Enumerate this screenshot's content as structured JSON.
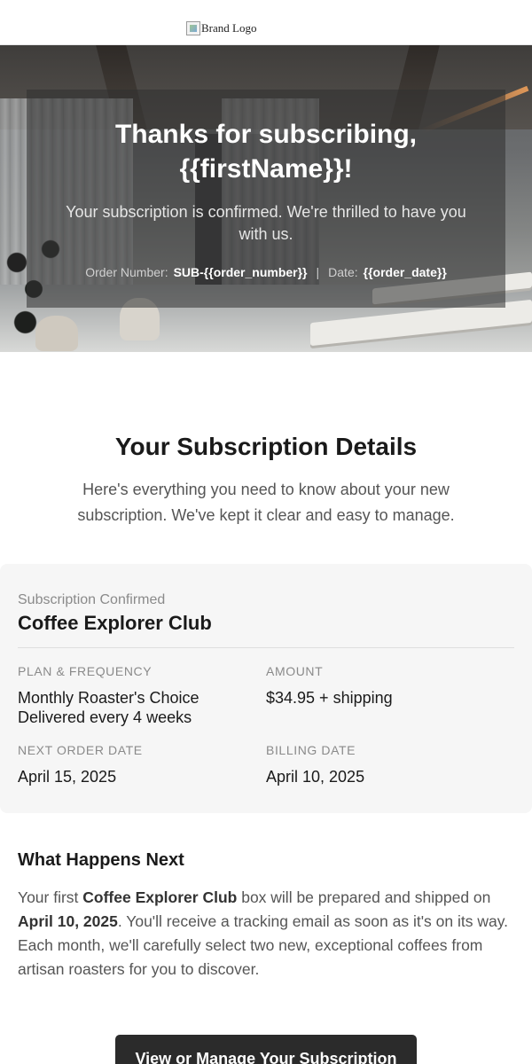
{
  "header": {
    "logo_alt": "Brand Logo",
    "logo_icon": "broken-image-icon"
  },
  "hero": {
    "title_line1": "Thanks for subscribing,",
    "title_line2": "{{firstName}}!",
    "subtitle": "Your subscription is confirmed. We're thrilled to have you with us.",
    "order_number_label": "Order Number:",
    "order_number_value": "SUB-{{order_number}}",
    "separator": "|",
    "date_label": "Date:",
    "date_value": "{{order_date}}"
  },
  "details": {
    "title": "Your Subscription Details",
    "description": "Here's everything you need to know about your new subscription. We've kept it clear and easy to manage."
  },
  "card": {
    "eyebrow": "Subscription Confirmed",
    "title": "Coffee Explorer Club",
    "fields": [
      {
        "label": "Plan & Frequency",
        "value_line1": "Monthly Roaster's Choice",
        "value_line2": "Delivered every 4 weeks"
      },
      {
        "label": "Amount",
        "value_line1": "$34.95 + shipping"
      },
      {
        "label": "Next Order Date",
        "value_line1": "April 15, 2025"
      },
      {
        "label": "Billing Date",
        "value_line1": "April 10, 2025"
      }
    ]
  },
  "next": {
    "title": "What Happens Next",
    "body_part1": "Your first ",
    "body_bold1": "Coffee Explorer Club",
    "body_part2": " box will be prepared and shipped on ",
    "body_bold2": "April 10, 2025",
    "body_part3": ". You'll receive a tracking email as soon as it's on its way. Each month, we'll carefully select two new, exceptional coffees from artisan roasters for you to discover."
  },
  "cta": {
    "label": "View or Manage Your Subscription"
  }
}
